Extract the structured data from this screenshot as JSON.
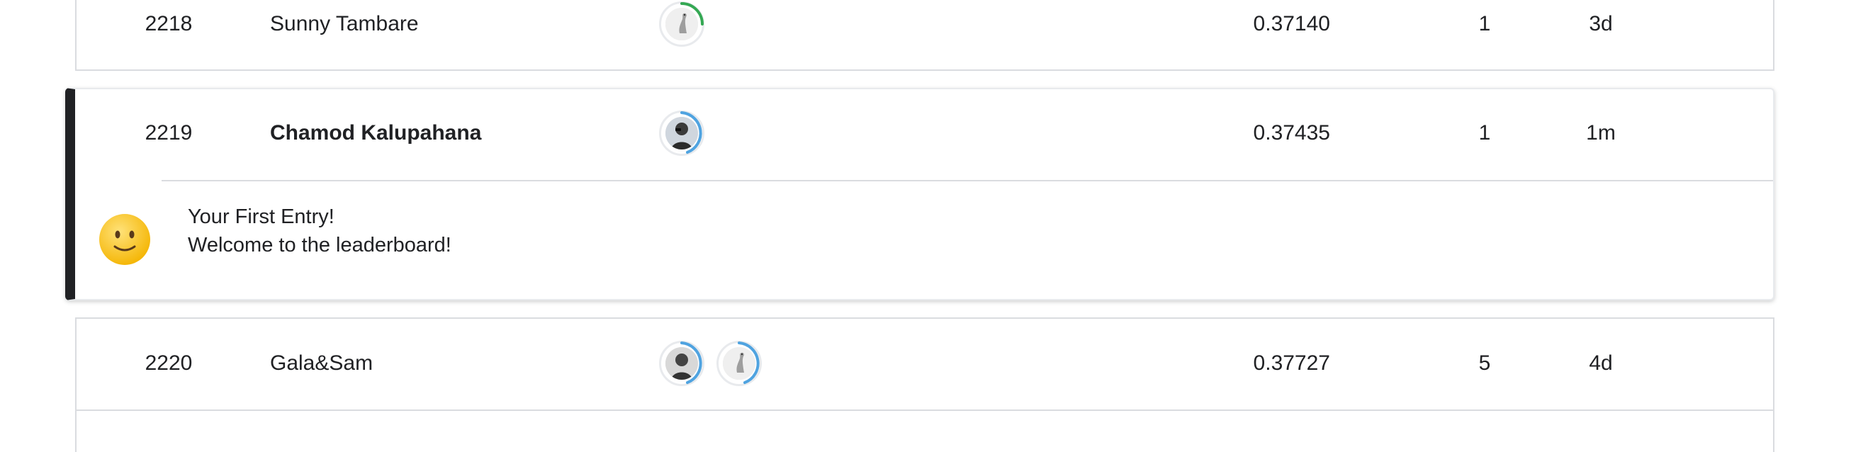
{
  "rows": [
    {
      "rank": "2218",
      "team": "Sunny Tambare",
      "avatars": [
        "goose-avatar"
      ],
      "score": "0.37140",
      "entries": "1",
      "last": "3d",
      "ring_color": "#34a853"
    },
    {
      "rank": "2219",
      "team": "Chamod Kalupahana",
      "avatars": [
        "user-photo-avatar"
      ],
      "score": "0.37435",
      "entries": "1",
      "last": "1m",
      "ring_color": "#4fa3e0"
    },
    {
      "rank": "2220",
      "team": "Gala&Sam",
      "avatars": [
        "user-photo-avatar",
        "goose-avatar"
      ],
      "score": "0.37727",
      "entries": "5",
      "last": "4d",
      "ring_color": "#4fa3e0"
    }
  ],
  "highlight_message": {
    "title": "Your First Entry!",
    "subtitle": "Welcome to the leaderboard!",
    "icon": "smiley-emoji-icon"
  },
  "colors": {
    "highlight_bar": "#202124",
    "border": "#dadce0",
    "ring_green": "#34a853",
    "ring_blue": "#4fa3e0"
  }
}
